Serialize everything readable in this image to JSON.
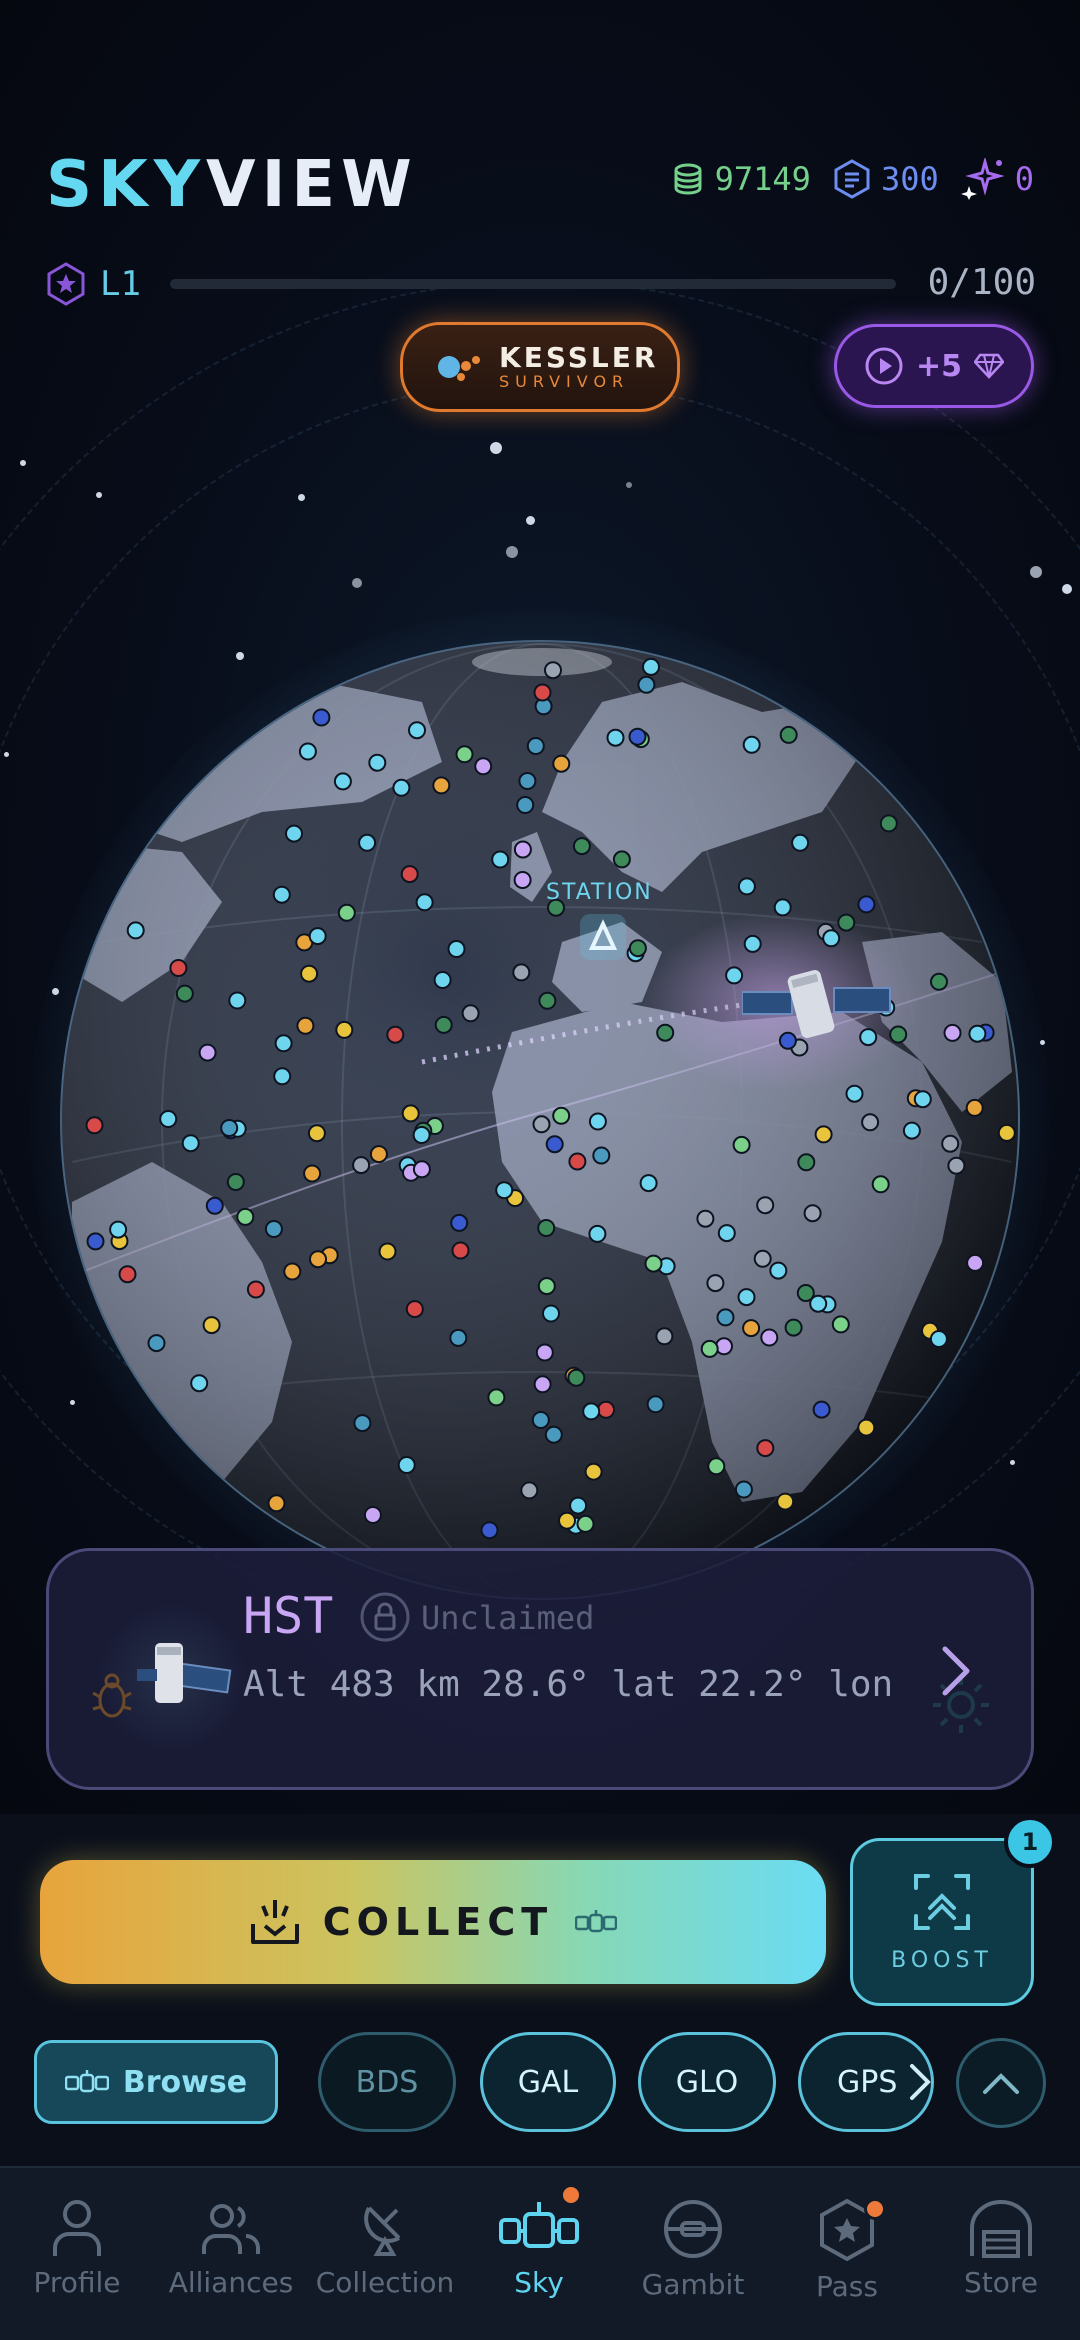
{
  "app": {
    "title_part1": "SKY",
    "title_part2": "VIEW"
  },
  "currencies": {
    "coins": "97149",
    "hex": "300",
    "spark": "0"
  },
  "level": {
    "label": "L1",
    "xp_text": "0/100",
    "progress": 0
  },
  "badge": {
    "line1": "KESSLER",
    "line2": "SURVIVOR"
  },
  "ad_boost": {
    "label": "+5"
  },
  "globe": {
    "station_label": "STATION"
  },
  "satellite": {
    "name": "HST",
    "status": "Unclaimed",
    "coords": "Alt 483 km  28.6° lat  22.2° lon"
  },
  "actions": {
    "collect_label": "COLLECT",
    "boost_label": "BOOST",
    "boost_badge": "1"
  },
  "filters": {
    "browse_label": "Browse",
    "chips": [
      {
        "label": "BDS",
        "active": false
      },
      {
        "label": "GAL",
        "active": true
      },
      {
        "label": "GLO",
        "active": true
      },
      {
        "label": "GPS",
        "active": true
      }
    ]
  },
  "tabs": [
    {
      "label": "Profile",
      "icon": "person-icon",
      "active": false,
      "dot": false
    },
    {
      "label": "Alliances",
      "icon": "people-icon",
      "active": false,
      "dot": false
    },
    {
      "label": "Collection",
      "icon": "dish-icon",
      "active": false,
      "dot": false
    },
    {
      "label": "Sky",
      "icon": "satellite-icon",
      "active": true,
      "dot": true
    },
    {
      "label": "Gambit",
      "icon": "gambit-icon",
      "active": false,
      "dot": false
    },
    {
      "label": "Pass",
      "icon": "star-hex-icon",
      "active": false,
      "dot": true
    },
    {
      "label": "Store",
      "icon": "hangar-icon",
      "active": false,
      "dot": false
    }
  ],
  "colors": {
    "accent_cyan": "#64d8f0",
    "coins_green": "#74d08a",
    "hex_blue": "#6d8ef0",
    "spark_purple": "#a66cf0",
    "badge_orange": "#e07a2e"
  }
}
